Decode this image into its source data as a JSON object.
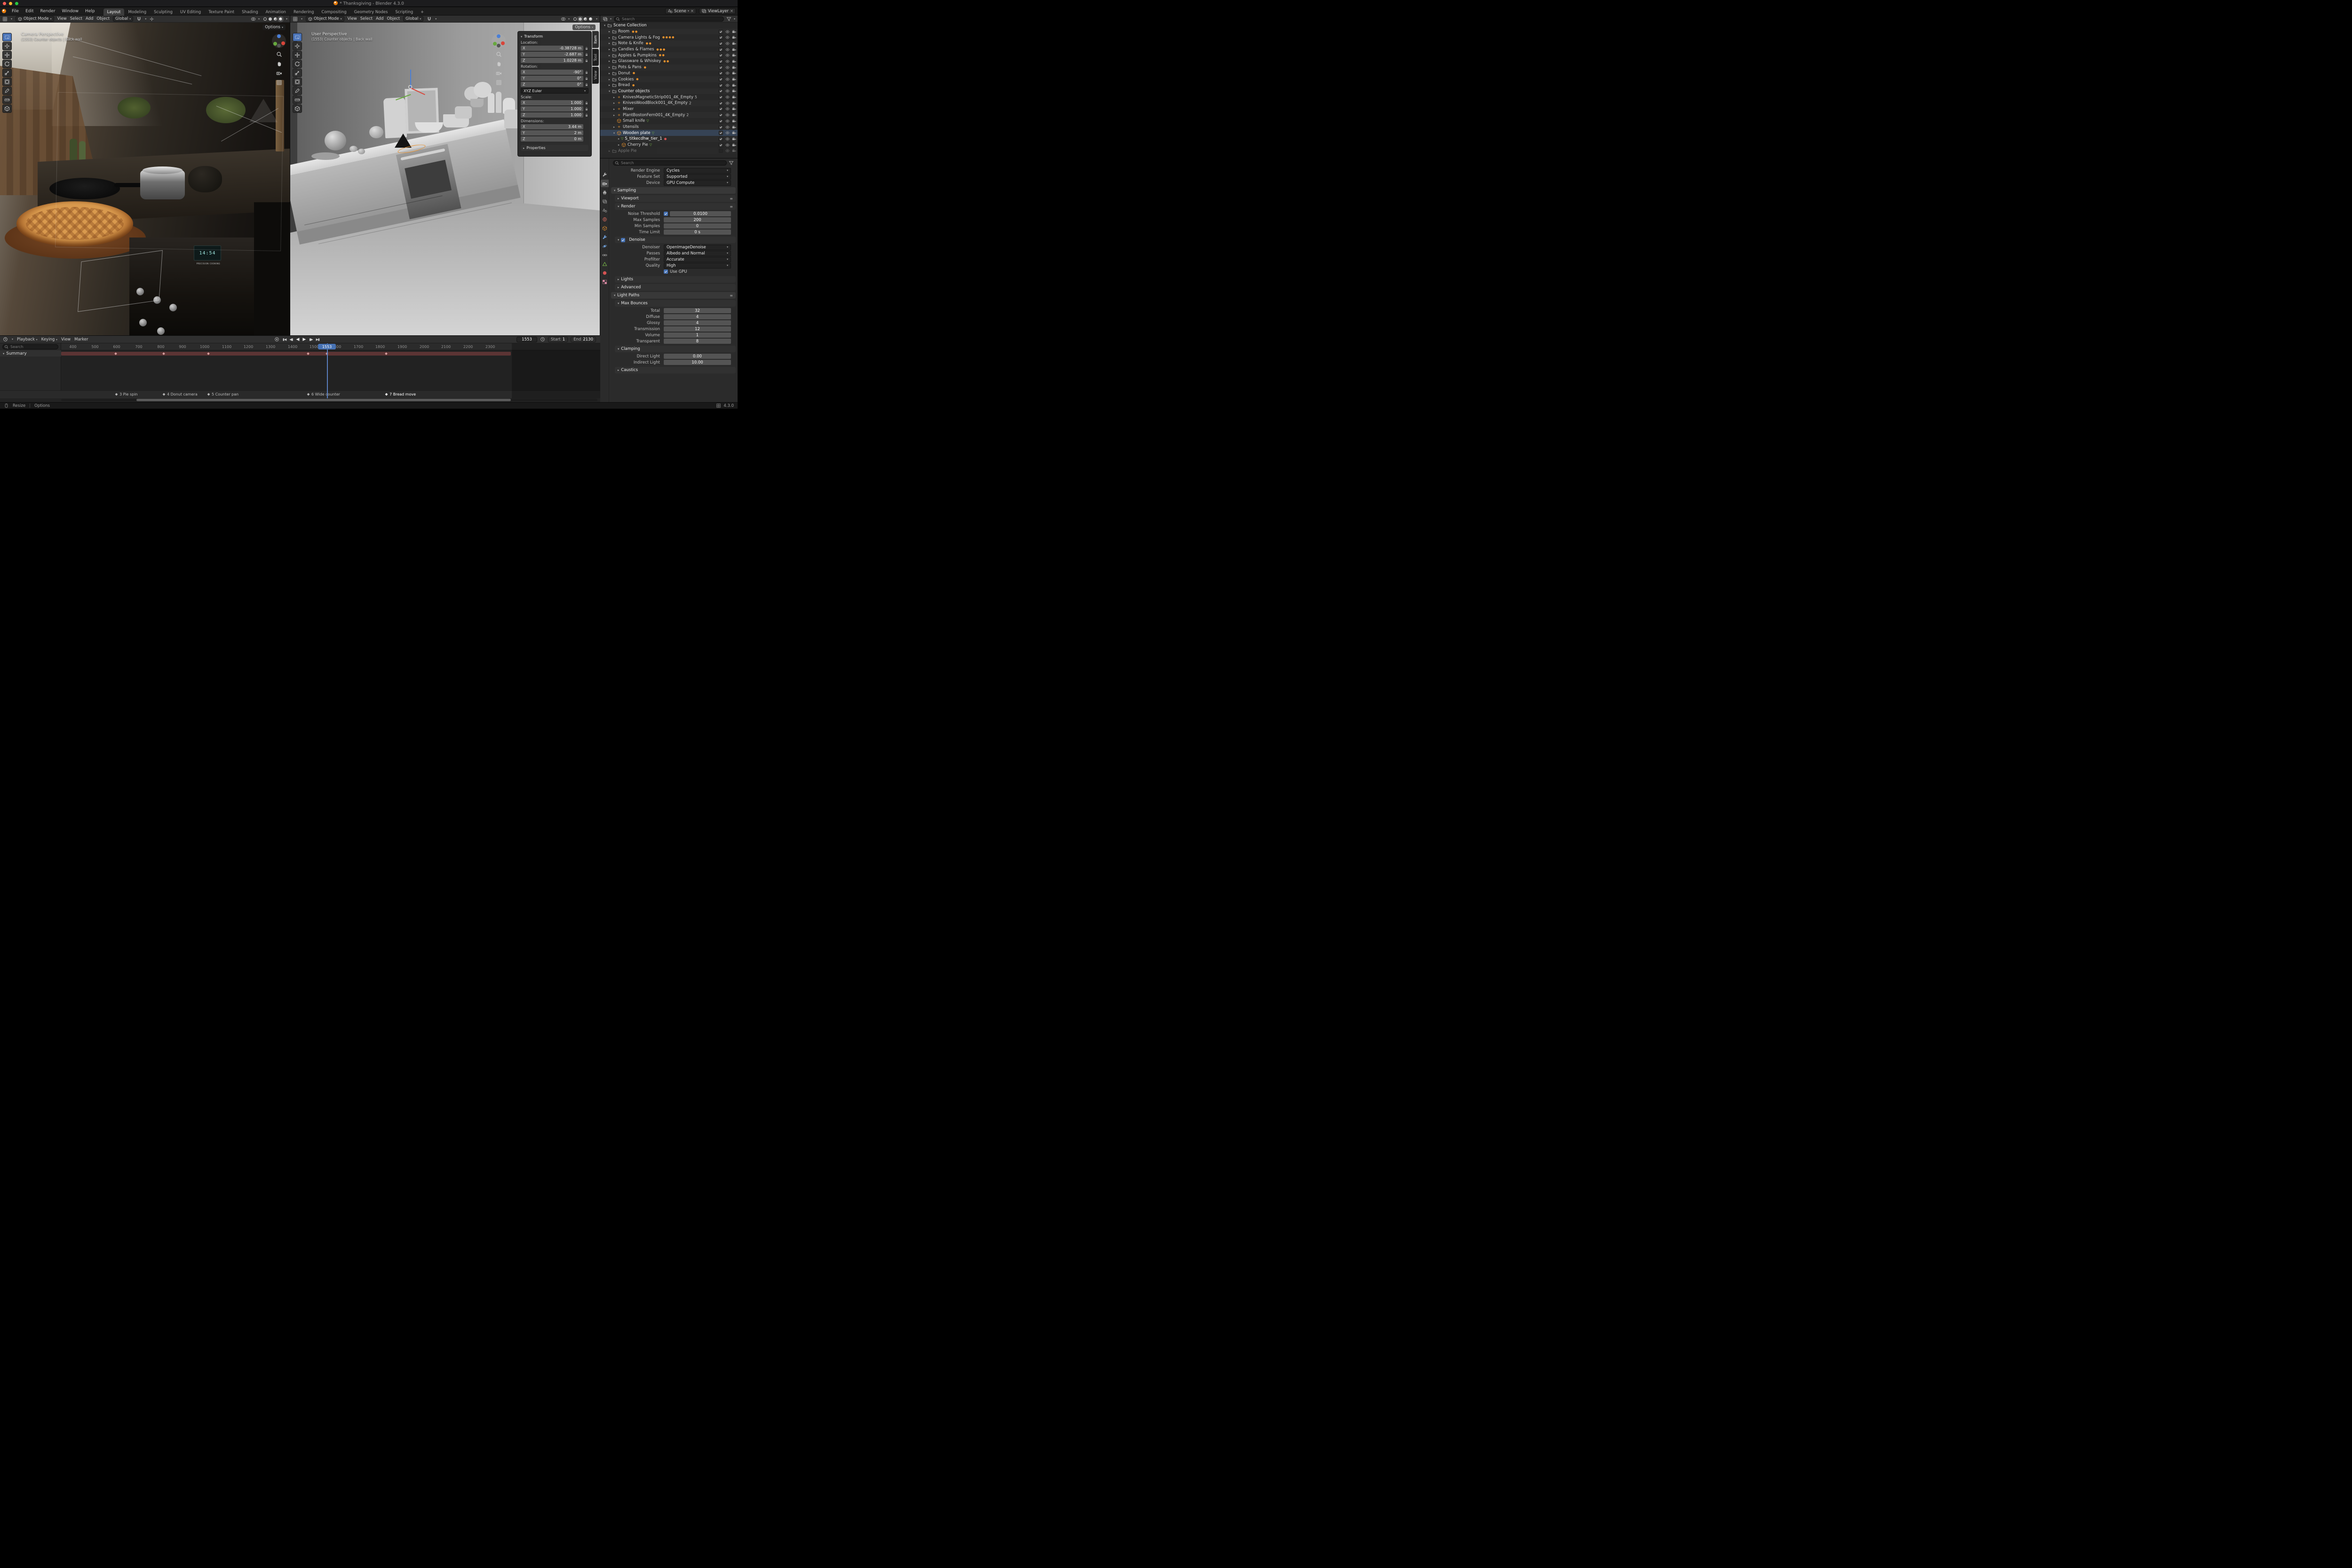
{
  "titlebar": {
    "title": "* Thanksgiving - Blender 4.3.0"
  },
  "topbar": {
    "menus": [
      "File",
      "Edit",
      "Render",
      "Window",
      "Help"
    ],
    "workspaces": [
      "Layout",
      "Modeling",
      "Sculpting",
      "UV Editing",
      "Texture Paint",
      "Shading",
      "Animation",
      "Rendering",
      "Compositing",
      "Geometry Nodes",
      "Scripting"
    ],
    "add_workspace": "+",
    "scene": "Scene",
    "view_layer": "ViewLayer"
  },
  "viewports": {
    "left": {
      "mode": "Object Mode",
      "menus": [
        "View",
        "Select",
        "Add",
        "Object"
      ],
      "orientation": "Global",
      "options": "Options",
      "view_name": "Camera Perspective",
      "context_line": "(1553) Counter objects | Back wall",
      "clock": "14:54",
      "brand": "PRECISION COOKING"
    },
    "right": {
      "mode": "Object Mode",
      "menus": [
        "View",
        "Select",
        "Add",
        "Object"
      ],
      "orientation": "Global",
      "options": "Options",
      "view_name": "User Perspective",
      "context_line": "(1553) Counter objects | Back wall"
    }
  },
  "npanel": {
    "tabs": [
      "Item",
      "Tool",
      "View"
    ],
    "transform_title": "Transform",
    "x": "X",
    "y": "Y",
    "z": "Z",
    "location_label": "Location:",
    "loc": {
      "x": "-0.38728 m",
      "y": "-2.687 m",
      "z": "1.0228 m"
    },
    "rotation_label": "Rotation:",
    "rot": {
      "x": "-90°",
      "y": "0°",
      "z": "0°"
    },
    "euler": "XYZ Euler",
    "scale_label": "Scale:",
    "scale": {
      "x": "1.000",
      "y": "1.000",
      "z": "1.000"
    },
    "dimensions_label": "Dimensions:",
    "dim": {
      "x": "3.44 m",
      "y": "2 m",
      "z": "0 m"
    },
    "properties_label": "Properties"
  },
  "outliner": {
    "search_placeholder": "Search",
    "rows": [
      {
        "label": "Scene Collection"
      },
      {
        "label": "Room"
      },
      {
        "label": "Camera Lights & Fog"
      },
      {
        "label": "Note & Knife"
      },
      {
        "label": "Candles & Flames"
      },
      {
        "label": "Apples & Pumpkins"
      },
      {
        "label": "Glassware & Whiskey"
      },
      {
        "label": "Pots & Pans"
      },
      {
        "label": "Donut"
      },
      {
        "label": "Cookies"
      },
      {
        "label": "Bread"
      },
      {
        "label": "Counter objects"
      },
      {
        "label": "KnivesMagneticStrip001_4K_Empty",
        "count": "5"
      },
      {
        "label": "KnivesWoodBlock001_4K_Empty",
        "count": "2"
      },
      {
        "label": "Mixer"
      },
      {
        "label": "PlantBostonFern001_4K_Empty",
        "count": "2"
      },
      {
        "label": "Small knife"
      },
      {
        "label": "Utensils"
      },
      {
        "label": "Wooden plate"
      },
      {
        "label": "S_titkecdhw_tier_1"
      },
      {
        "label": "Cherry Pie"
      },
      {
        "label": "Apple Pie"
      }
    ]
  },
  "properties": {
    "search_placeholder": "Search",
    "engine_label": "Render Engine",
    "engine": "Cycles",
    "feature_label": "Feature Set",
    "feature": "Supported",
    "device_label": "Device",
    "device": "GPU Compute",
    "sampling_title": "Sampling",
    "viewport_title": "Viewport",
    "render_title": "Render",
    "noise_label": "Noise Threshold",
    "noise": "0.0100",
    "max_samples_label": "Max Samples",
    "max_samples": "200",
    "min_samples_label": "Min Samples",
    "min_samples": "0",
    "time_limit_label": "Time Limit",
    "time_limit": "0 s",
    "denoise_title": "Denoise",
    "denoiser_label": "Denoiser",
    "denoiser": "OpenImageDenoise",
    "passes_label": "Passes",
    "passes": "Albedo and Normal",
    "prefilter_label": "Prefilter",
    "prefilter": "Accurate",
    "quality_label": "Quality",
    "quality": "High",
    "use_gpu": "Use GPU",
    "lights_title": "Lights",
    "advanced_title": "Advanced",
    "light_paths_title": "Light Paths",
    "max_bounces_title": "Max Bounces",
    "total_label": "Total",
    "total": "32",
    "diffuse_label": "Diffuse",
    "diffuse": "4",
    "glossy_label": "Glossy",
    "glossy": "4",
    "transmission_label": "Transmission",
    "transmission": "12",
    "volume_label": "Volume",
    "volume": "1",
    "transparent_label": "Transparent",
    "transparent": "8",
    "clamping_title": "Clamping",
    "direct_label": "Direct Light",
    "direct": "0.00",
    "indirect_label": "Indirect Light",
    "indirect": "10.00",
    "caustics_title": "Caustics"
  },
  "timeline": {
    "menus": [
      "Playback",
      "Keying",
      "View",
      "Marker"
    ],
    "current_frame": "1553",
    "start_label": "Start",
    "start_value": "1",
    "end_label": "End",
    "end_value": "2130",
    "ruler": [
      "400",
      "500",
      "600",
      "700",
      "800",
      "900",
      "1000",
      "1100",
      "1200",
      "1300",
      "1400",
      "1500",
      "1600",
      "1700",
      "1800",
      "1900",
      "2000",
      "2100",
      "2200",
      "2300"
    ],
    "summary_label": "Summary",
    "search_placeholder": "Search",
    "markers": [
      "3 Pie spin",
      "4 Donut camera",
      "5 Counter pan",
      "6 Wide counter",
      "7 Bread move"
    ]
  },
  "statusbar": {
    "resize": "Resize",
    "options": "Options",
    "version": "4.3.0"
  }
}
